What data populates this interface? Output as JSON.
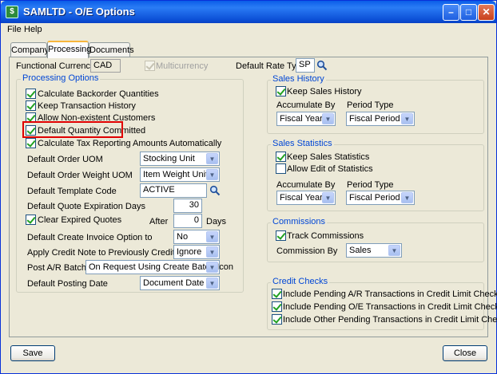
{
  "window": {
    "title": "SAMLTD - O/E Options"
  },
  "menu": {
    "file": "File",
    "help": "Help"
  },
  "tabs": {
    "company": "Company",
    "processing": "Processing",
    "documents": "Documents"
  },
  "header": {
    "functional_currency_label": "Functional Currency",
    "functional_currency_value": "CAD",
    "multicurrency_label": "Multicurrency",
    "default_rate_type_label": "Default Rate Type",
    "default_rate_type_value": "SP"
  },
  "processing_options": {
    "group_label": "Processing Options",
    "calc_backorder": "Calculate Backorder Quantities",
    "keep_history": "Keep Transaction History",
    "allow_nonexistent": "Allow Non-existent Customers",
    "default_qty_committed": "Default Quantity Committed",
    "calc_tax_reporting": "Calculate Tax Reporting Amounts Automatically",
    "default_order_uom_label": "Default Order UOM",
    "default_order_uom_value": "Stocking Unit",
    "default_weight_uom_label": "Default Order Weight UOM",
    "default_weight_uom_value": "Item Weight Unit",
    "default_template_label": "Default Template Code",
    "default_template_value": "ACTIVE",
    "quote_expiration_label": "Default Quote Expiration Days",
    "quote_expiration_value": "30",
    "clear_expired_label": "Clear Expired Quotes",
    "after_label": "After",
    "after_value": "0",
    "days_label": "Days",
    "create_invoice_label": "Default Create Invoice Option to",
    "create_invoice_value": "No",
    "apply_credit_label": "Apply Credit Note to Previously Credited Invoice",
    "apply_credit_value": "Ignore",
    "post_ar_label": "Post A/R Batches",
    "post_ar_value": "On Request Using Create Batch Icon",
    "posting_date_label": "Default Posting Date",
    "posting_date_value": "Document Date"
  },
  "sales_history": {
    "group_label": "Sales History",
    "keep_label": "Keep Sales History",
    "accumulate_label": "Accumulate By",
    "accumulate_value": "Fiscal Year",
    "period_label": "Period Type",
    "period_value": "Fiscal Period"
  },
  "sales_statistics": {
    "group_label": "Sales Statistics",
    "keep_label": "Keep Sales Statistics",
    "allow_edit_label": "Allow Edit of Statistics",
    "accumulate_label": "Accumulate By",
    "accumulate_value": "Fiscal Year",
    "period_label": "Period Type",
    "period_value": "Fiscal Period"
  },
  "commissions": {
    "group_label": "Commissions",
    "track_label": "Track Commissions",
    "commission_by_label": "Commission By",
    "commission_by_value": "Sales"
  },
  "credit_checks": {
    "group_label": "Credit Checks",
    "pending_ar": "Include Pending A/R Transactions in Credit Limit Check",
    "pending_oe": "Include Pending O/E Transactions in Credit Limit Check",
    "pending_other": "Include Other Pending Transactions in Credit Limit Check"
  },
  "footer": {
    "save": "Save",
    "close": "Close"
  },
  "colors": {
    "highlight": "#e00000",
    "group_label": "#0046d5",
    "titlebar": "#0a5ce8"
  }
}
